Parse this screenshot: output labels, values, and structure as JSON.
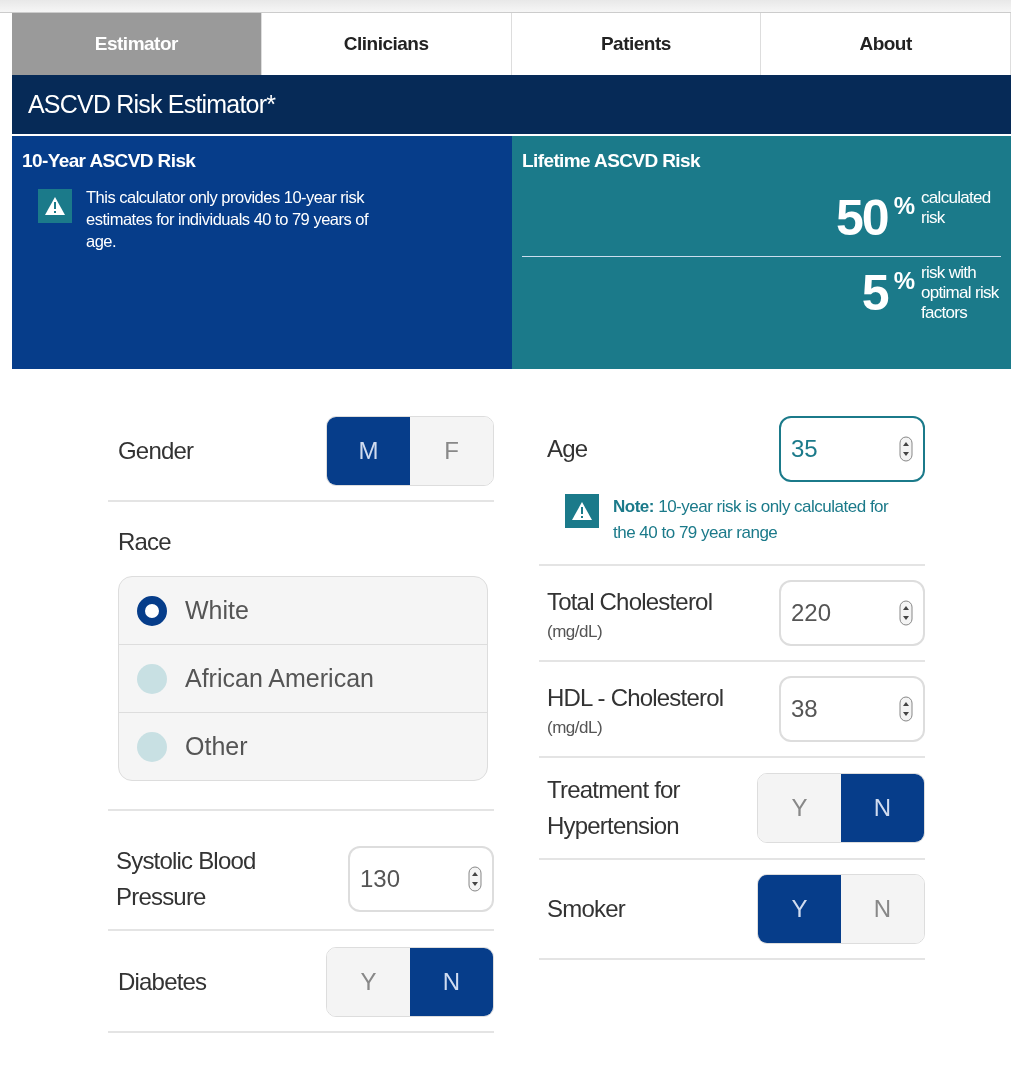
{
  "tabs": [
    {
      "label": "Estimator",
      "selected": true
    },
    {
      "label": "Clinicians",
      "selected": false
    },
    {
      "label": "Patients",
      "selected": false
    },
    {
      "label": "About",
      "selected": false
    }
  ],
  "title": "ASCVD Risk Estimator*",
  "ten_year": {
    "title": "10-Year ASCVD Risk",
    "warning": "This calculator only provides 10-year risk estimates for individuals 40 to 79 years of age."
  },
  "lifetime": {
    "title": "Lifetime ASCVD Risk",
    "results": [
      {
        "value": "50",
        "unit": "%",
        "label": "calculated risk"
      },
      {
        "value": "5",
        "unit": "%",
        "label": "risk with optimal risk factors"
      }
    ]
  },
  "left_fields": [
    {
      "kind": "toggle",
      "label": "Gender",
      "options": [
        {
          "label": "M",
          "selected": true
        },
        {
          "label": "F",
          "selected": false
        }
      ]
    },
    {
      "kind": "radio",
      "label": "Race",
      "options": [
        {
          "label": "White",
          "selected": true
        },
        {
          "label": "African American",
          "selected": false
        },
        {
          "label": "Other",
          "selected": false
        }
      ]
    },
    {
      "kind": "number",
      "label": "Systolic Blood Pressure",
      "value": "130",
      "focused": false
    },
    {
      "kind": "toggle",
      "label": "Diabetes",
      "options": [
        {
          "label": "Y",
          "selected": false
        },
        {
          "label": "N",
          "selected": true
        }
      ]
    }
  ],
  "right_fields": [
    {
      "kind": "number",
      "label": "Age",
      "value": "35",
      "focused": true,
      "note": "**Note:** 10-year risk is only calculated for the 40 to 79 year range"
    },
    {
      "kind": "number",
      "label": "Total Cholesterol",
      "unit": "(mg/dL)",
      "value": "220",
      "focused": false
    },
    {
      "kind": "number",
      "label": "HDL - Cholesterol",
      "unit": "(mg/dL)",
      "value": "38",
      "focused": false
    },
    {
      "kind": "toggle",
      "label": "Treatment for Hypertension",
      "options": [
        {
          "label": "Y",
          "selected": false
        },
        {
          "label": "N",
          "selected": true
        }
      ]
    },
    {
      "kind": "toggle",
      "label": "Smoker",
      "options": [
        {
          "label": "Y",
          "selected": true
        },
        {
          "label": "N",
          "selected": false
        }
      ]
    }
  ]
}
